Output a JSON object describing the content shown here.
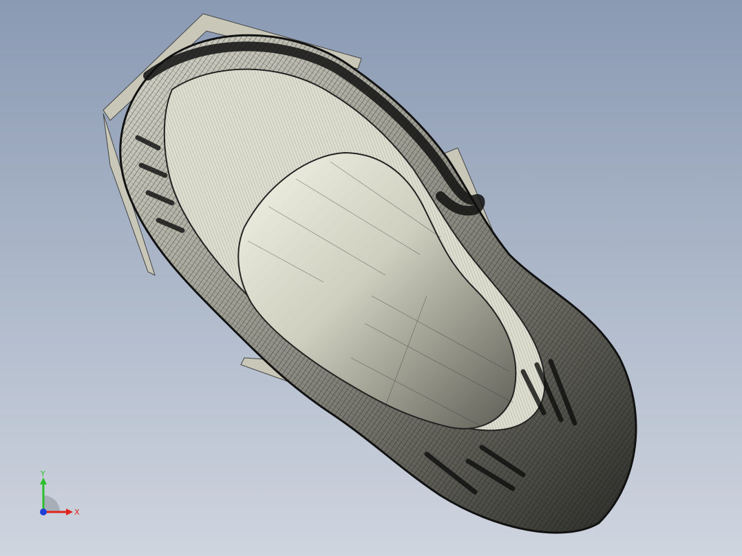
{
  "viewport": {
    "background_top": "#8a9ab3",
    "background_bottom": "#cfd5df"
  },
  "model": {
    "mesh_color": "#1a1a1a",
    "surface_light": "#e6e6d8",
    "surface_dark": "#6f6f66",
    "sheet_color": "#c9c7b8"
  },
  "triad": {
    "x_label": "X",
    "y_label": "Y",
    "x_color": "#e0241b",
    "y_color": "#2bbf2b",
    "z_color": "#1f3fd6"
  }
}
